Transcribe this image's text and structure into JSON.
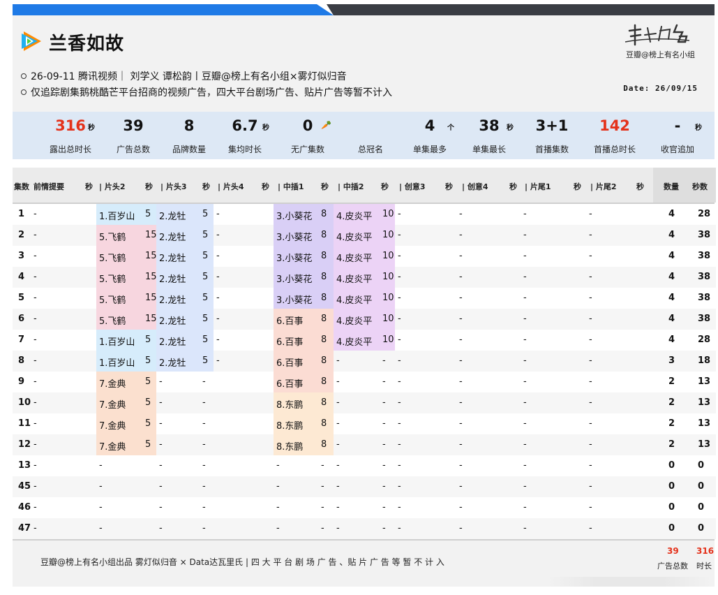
{
  "header": {
    "title": "兰香如故",
    "brand_mark": "榜上有名",
    "brand_sub": "豆瓣@榜上有名小组",
    "info_line1": "26-09-11 腾讯视频｜ 刘学义 谭松韵丨豆瓣@榜上有名小组×雾灯似归音",
    "info_line2": "仅追踪剧集鹅桃酷芒平台招商的视频广告，四大平台剧场广告、贴片广告等暂不计入",
    "date": "Date: 26/09/15"
  },
  "stats": [
    {
      "value": "316",
      "unit": "秒",
      "label": "露出总时长",
      "color": "#e4321b"
    },
    {
      "value": "39",
      "unit": "",
      "label": "广告总数",
      "color": "#111111"
    },
    {
      "value": "8",
      "unit": "",
      "label": "品牌数量",
      "color": "#111111"
    },
    {
      "value": "6.7",
      "unit": "秒",
      "label": "集均时长",
      "color": "#111111"
    },
    {
      "value": "0",
      "unit": "",
      "label": "无广集数",
      "color": "#111111"
    },
    {
      "value": "",
      "unit": "",
      "label": "总冠名",
      "color": "#111111"
    },
    {
      "value": "4",
      "unit": "个",
      "label": "单集最多",
      "color": "#111111"
    },
    {
      "value": "38",
      "unit": "秒",
      "label": "单集最长",
      "color": "#111111"
    },
    {
      "value": "3+1",
      "unit": "",
      "label": "首播集数",
      "color": "#111111"
    },
    {
      "value": "142",
      "unit": "",
      "label": "首播总时长",
      "color": "#e4321b"
    },
    {
      "value": "-",
      "unit": "秒",
      "label": "收官追加",
      "color": "#111111"
    }
  ],
  "table": {
    "headers": {
      "ep": "集数",
      "recap": "前情提要",
      "sec": "秒",
      "h2": "| 片头2",
      "h3": "| 片头3",
      "h4": "| 片头4",
      "m1": "| 中插1",
      "m2": "| 中插2",
      "c3": "| 创意3",
      "c4": "| 创意4",
      "e1": "| 片尾1",
      "e2": "| 片尾2",
      "count": "数量",
      "total": "秒数"
    },
    "rows": [
      {
        "ep": "1",
        "recap": "-",
        "h2": "1.百岁山",
        "h2s": "5",
        "h3": "2.龙牡",
        "h3s": "5",
        "h4": "-",
        "m1": "3.小葵花",
        "m1s": "8",
        "m2": "4.皮炎平",
        "m2s": "10",
        "c3": "-",
        "c4": "-",
        "e1": "-",
        "e2": "-",
        "count": "4",
        "total": "28"
      },
      {
        "ep": "2",
        "recap": "-",
        "h2": "5.飞鹤",
        "h2s": "15",
        "h3": "2.龙牡",
        "h3s": "5",
        "h4": "-",
        "m1": "3.小葵花",
        "m1s": "8",
        "m2": "4.皮炎平",
        "m2s": "10",
        "c3": "-",
        "c4": "-",
        "e1": "-",
        "e2": "-",
        "count": "4",
        "total": "38"
      },
      {
        "ep": "3",
        "recap": "-",
        "h2": "5.飞鹤",
        "h2s": "15",
        "h3": "2.龙牡",
        "h3s": "5",
        "h4": "-",
        "m1": "3.小葵花",
        "m1s": "8",
        "m2": "4.皮炎平",
        "m2s": "10",
        "c3": "-",
        "c4": "-",
        "e1": "-",
        "e2": "-",
        "count": "4",
        "total": "38"
      },
      {
        "ep": "4",
        "recap": "-",
        "h2": "5.飞鹤",
        "h2s": "15",
        "h3": "2.龙牡",
        "h3s": "5",
        "h4": "-",
        "m1": "3.小葵花",
        "m1s": "8",
        "m2": "4.皮炎平",
        "m2s": "10",
        "c3": "-",
        "c4": "-",
        "e1": "-",
        "e2": "-",
        "count": "4",
        "total": "38"
      },
      {
        "ep": "5",
        "recap": "-",
        "h2": "5.飞鹤",
        "h2s": "15",
        "h3": "2.龙牡",
        "h3s": "5",
        "h4": "-",
        "m1": "3.小葵花",
        "m1s": "8",
        "m2": "4.皮炎平",
        "m2s": "10",
        "c3": "-",
        "c4": "-",
        "e1": "-",
        "e2": "-",
        "count": "4",
        "total": "38"
      },
      {
        "ep": "6",
        "recap": "-",
        "h2": "5.飞鹤",
        "h2s": "15",
        "h3": "2.龙牡",
        "h3s": "5",
        "h4": "-",
        "m1": "6.百事",
        "m1s": "8",
        "m2": "4.皮炎平",
        "m2s": "10",
        "c3": "-",
        "c4": "-",
        "e1": "-",
        "e2": "-",
        "count": "4",
        "total": "38"
      },
      {
        "ep": "7",
        "recap": "-",
        "h2": "1.百岁山",
        "h2s": "5",
        "h3": "2.龙牡",
        "h3s": "5",
        "h4": "-",
        "m1": "6.百事",
        "m1s": "8",
        "m2": "4.皮炎平",
        "m2s": "10",
        "c3": "-",
        "c4": "-",
        "e1": "-",
        "e2": "-",
        "count": "4",
        "total": "28"
      },
      {
        "ep": "8",
        "recap": "-",
        "h2": "1.百岁山",
        "h2s": "5",
        "h3": "2.龙牡",
        "h3s": "5",
        "h4": "-",
        "m1": "6.百事",
        "m1s": "8",
        "m2": "-",
        "m2s": "-",
        "c3": "-",
        "c4": "-",
        "e1": "-",
        "e2": "-",
        "count": "3",
        "total": "18"
      },
      {
        "ep": "9",
        "recap": "-",
        "h2": "7.金典",
        "h2s": "5",
        "h3": "-",
        "h3s": "-",
        "h4": "",
        "m1": "6.百事",
        "m1s": "8",
        "m2": "-",
        "m2s": "-",
        "c3": "-",
        "c4": "-",
        "e1": "-",
        "e2": "-",
        "count": "2",
        "total": "13"
      },
      {
        "ep": "10",
        "recap": "-",
        "h2": "7.金典",
        "h2s": "5",
        "h3": "-",
        "h3s": "-",
        "h4": "",
        "m1": "8.东鹏",
        "m1s": "8",
        "m2": "-",
        "m2s": "-",
        "c3": "-",
        "c4": "-",
        "e1": "-",
        "e2": "-",
        "count": "2",
        "total": "13"
      },
      {
        "ep": "11",
        "recap": "-",
        "h2": "7.金典",
        "h2s": "5",
        "h3": "-",
        "h3s": "-",
        "h4": "",
        "m1": "8.东鹏",
        "m1s": "8",
        "m2": "-",
        "m2s": "-",
        "c3": "-",
        "c4": "-",
        "e1": "-",
        "e2": "-",
        "count": "2",
        "total": "13"
      },
      {
        "ep": "12",
        "recap": "-",
        "h2": "7.金典",
        "h2s": "5",
        "h3": "-",
        "h3s": "-",
        "h4": "",
        "m1": "8.东鹏",
        "m1s": "8",
        "m2": "-",
        "m2s": "-",
        "c3": "-",
        "c4": "-",
        "e1": "-",
        "e2": "-",
        "count": "2",
        "total": "13"
      },
      {
        "ep": "13",
        "recap": "-",
        "h2": "-",
        "h2s": "",
        "h3": "-",
        "h3s": "-",
        "h4": "",
        "m1": "-",
        "m1s": "-",
        "m2": "-",
        "m2s": "-",
        "c3": "-",
        "c4": "-",
        "e1": "-",
        "e2": "-",
        "count": "0",
        "total": "0"
      },
      {
        "ep": "45",
        "recap": "-",
        "h2": "-",
        "h2s": "",
        "h3": "-",
        "h3s": "-",
        "h4": "",
        "m1": "-",
        "m1s": "-",
        "m2": "-",
        "m2s": "-",
        "c3": "-",
        "c4": "-",
        "e1": "-",
        "e2": "-",
        "count": "0",
        "total": "0"
      },
      {
        "ep": "46",
        "recap": "-",
        "h2": "-",
        "h2s": "",
        "h3": "-",
        "h3s": "-",
        "h4": "",
        "m1": "-",
        "m1s": "-",
        "m2": "-",
        "m2s": "-",
        "c3": "-",
        "c4": "-",
        "e1": "-",
        "e2": "-",
        "count": "0",
        "total": "0"
      },
      {
        "ep": "47",
        "recap": "-",
        "h2": "-",
        "h2s": "",
        "h3": "-",
        "h3s": "-",
        "h4": "",
        "m1": "-",
        "m1s": "-",
        "m2": "-",
        "m2s": "-",
        "c3": "-",
        "c4": "-",
        "e1": "-",
        "e2": "-",
        "count": "0",
        "total": "0"
      }
    ]
  },
  "footer": {
    "text": "豆瓣@榜上有名小组出品 雾灯似归音 × Data达瓦里氏 | 四 大 平 台 剧 场 广 告 、贴 片 广 告 等 暂 不 计 入",
    "ads_total": "39",
    "sec_total": "316",
    "ads_label": "广告总数",
    "sec_label": "时长"
  },
  "colors": {
    "accent_blue": "#1f7ae6",
    "accent_red": "#e4321b",
    "bar_dark": "#3a3d44"
  }
}
